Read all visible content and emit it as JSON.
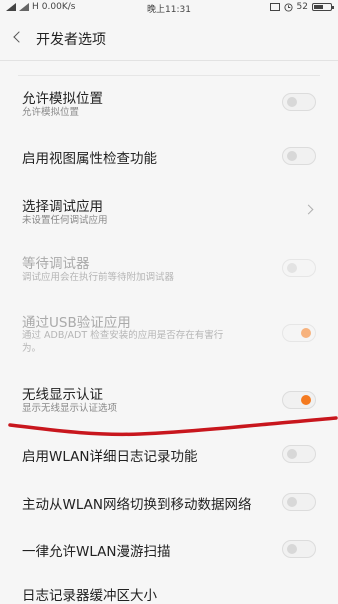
{
  "status_bar": {
    "network": "H",
    "speed": "0.00K/s",
    "time": "晚上11:31",
    "battery": "52",
    "icons": [
      "signal-icon",
      "sim-card-icon",
      "alarm-icon",
      "battery-icon"
    ]
  },
  "header": {
    "title": "开发者选项",
    "back_icon": "chevron-left-icon"
  },
  "settings": [
    {
      "label": "允许模拟位置",
      "sub": "允许模拟位置",
      "control": "toggle",
      "on": false,
      "enabled": true
    },
    {
      "label": "启用视图属性检查功能",
      "control": "toggle",
      "on": false,
      "enabled": true
    },
    {
      "label": "选择调试应用",
      "sub": "未设置任何调试应用",
      "control": "chevron",
      "enabled": true
    },
    {
      "label": "等待调试器",
      "sub": "调试应用会在执行前等待附加调试器",
      "control": "toggle",
      "on": false,
      "enabled": false
    },
    {
      "label": "通过USB验证应用",
      "sub_lines": [
        "通过 ADB/ADT 检查安装的应用是否存在有害行",
        "为。"
      ],
      "control": "toggle",
      "on": true,
      "enabled": false
    },
    {
      "label": "无线显示认证",
      "sub": "显示无线显示认证选项",
      "control": "toggle",
      "on": true,
      "enabled": true
    },
    {
      "label": "启用WLAN详细日志记录功能",
      "control": "toggle",
      "on": false,
      "enabled": true
    },
    {
      "label": "主动从WLAN网络切换到移动数据网络",
      "control": "toggle",
      "on": false,
      "enabled": true
    },
    {
      "label": "一律允许WLAN漫游扫描",
      "control": "toggle",
      "on": false,
      "enabled": true
    },
    {
      "label": "日志记录器缓冲区大小",
      "control": "chevron",
      "enabled": true
    }
  ],
  "colors": {
    "accent": "#f47a20",
    "annotation": "#c8161d",
    "background": "#f6f6f6"
  }
}
